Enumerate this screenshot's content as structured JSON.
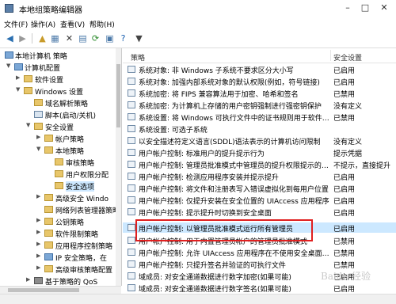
{
  "window": {
    "title": "本地组策略编辑器"
  },
  "menu": [
    "文件(F)",
    "操作(A)",
    "查看(V)",
    "帮助(H)"
  ],
  "toolbar": {
    "icons": [
      "back-icon",
      "forward-icon",
      "up-folder-icon",
      "show-tree-icon",
      "delete-icon",
      "properties-icon",
      "refresh-icon",
      "export-icon",
      "help-icon",
      "filter-icon"
    ]
  },
  "tree": {
    "items": [
      {
        "label": "本地计算机 策略",
        "level": 0,
        "icon": "pc"
      },
      {
        "label": "计算机配置",
        "level": 1,
        "icon": "pc",
        "arrow": "▼"
      },
      {
        "label": "软件设置",
        "level": 2,
        "icon": "folder",
        "arrow": "▶"
      },
      {
        "label": "Windows 设置",
        "level": 2,
        "icon": "folder",
        "arrow": "▼"
      },
      {
        "label": "域名解析策略",
        "level": 3,
        "icon": "folder"
      },
      {
        "label": "脚本(启动/关机)",
        "level": 3,
        "icon": "doc"
      },
      {
        "label": "安全设置",
        "level": 3,
        "icon": "folder",
        "arrow": "▼"
      },
      {
        "label": "帐户策略",
        "level": 4,
        "icon": "folder",
        "arrow": "▶"
      },
      {
        "label": "本地策略",
        "level": 4,
        "icon": "folder",
        "arrow": "▼"
      },
      {
        "label": "审核策略",
        "level": 5,
        "icon": "folder"
      },
      {
        "label": "用户权限分配",
        "level": 5,
        "icon": "folder"
      },
      {
        "label": "安全选项",
        "level": 5,
        "icon": "folder",
        "selected": true
      },
      {
        "label": "高级安全 Windo",
        "level": 4,
        "icon": "folder",
        "arrow": "▶"
      },
      {
        "label": "网络列表管理器策略",
        "level": 4,
        "icon": "folder"
      },
      {
        "label": "公钥策略",
        "level": 4,
        "icon": "folder",
        "arrow": "▶"
      },
      {
        "label": "软件限制策略",
        "level": 4,
        "icon": "folder",
        "arrow": "▶"
      },
      {
        "label": "应用程序控制策略",
        "level": 4,
        "icon": "folder",
        "arrow": "▶"
      },
      {
        "label": "IP 安全策略，在",
        "level": 4,
        "icon": "pc",
        "arrow": "▶"
      },
      {
        "label": "高级审核策略配置",
        "level": 4,
        "icon": "folder",
        "arrow": "▶"
      },
      {
        "label": "基于策略的 QoS",
        "level": 3,
        "icon": "folder",
        "arrow": "▶"
      }
    ]
  },
  "list": {
    "columns": {
      "policy": "策略",
      "setting": "安全设置"
    },
    "rows": [
      {
        "name": "系统对象: 非 Windows 子系统不要求区分大小写",
        "value": "已启用"
      },
      {
        "name": "系统对象: 加强内部系统对象的默认权限(例如，符号链接)",
        "value": "已启用"
      },
      {
        "name": "系统加密: 将 FIPS 兼容算法用于加密、哈希和签名",
        "value": "已禁用"
      },
      {
        "name": "系统加密: 为计算机上存储的用户密钥强制进行强密钥保护",
        "value": "没有定义"
      },
      {
        "name": "系统设置: 将 Windows 可执行文件中的证书规则用于软件…",
        "value": "已禁用"
      },
      {
        "name": "系统设置: 可选子系统",
        "value": ""
      },
      {
        "name": "以安全描述符定义语言(SDDL)语法表示的计算机访问限制",
        "value": "没有定义"
      },
      {
        "name": "用户帐户控制: 标准用户的提升提示行为",
        "value": "提示凭据"
      },
      {
        "name": "用户帐户控制: 管理员批准模式中管理员的提升权限提示的…",
        "value": "不提示，直接提升"
      },
      {
        "name": "用户帐户控制: 检测应用程序安装并提示提升",
        "value": "已启用"
      },
      {
        "name": "用户帐户控制: 将文件和注册表写入错误虚拟化到每用户位置",
        "value": "已启用"
      },
      {
        "name": "用户帐户控制: 仅提升安装在安全位置的 UIAccess 应用程序",
        "value": "已启用"
      },
      {
        "name": "用户帐户控制: 提示提升时切换到安全桌面",
        "value": "已启用"
      },
      {
        "name": "用户帐户控制: 以管理员批准模式运行所有管理员",
        "value": "已启用",
        "selected": true
      },
      {
        "name": "用户帐户控制: 用于内置管理员帐户的管理员批准模式",
        "value": "已禁用"
      },
      {
        "name": "用户帐户控制: 允许 UIAccess 应用程序在不使用安全桌面…",
        "value": "已禁用"
      },
      {
        "name": "用户帐户控制: 只提升签名并验证的可执行文件",
        "value": "已禁用"
      },
      {
        "name": "域成员: 对安全通道数据进行数字加密(如果可能)",
        "value": "已启用"
      },
      {
        "name": "域成员: 对安全通道数据进行数字签名(如果可能)",
        "value": "已启用"
      }
    ]
  },
  "watermark": "Baidu 经验",
  "colors": {
    "selection": "#cce8ff",
    "highlight": "#e02020"
  }
}
